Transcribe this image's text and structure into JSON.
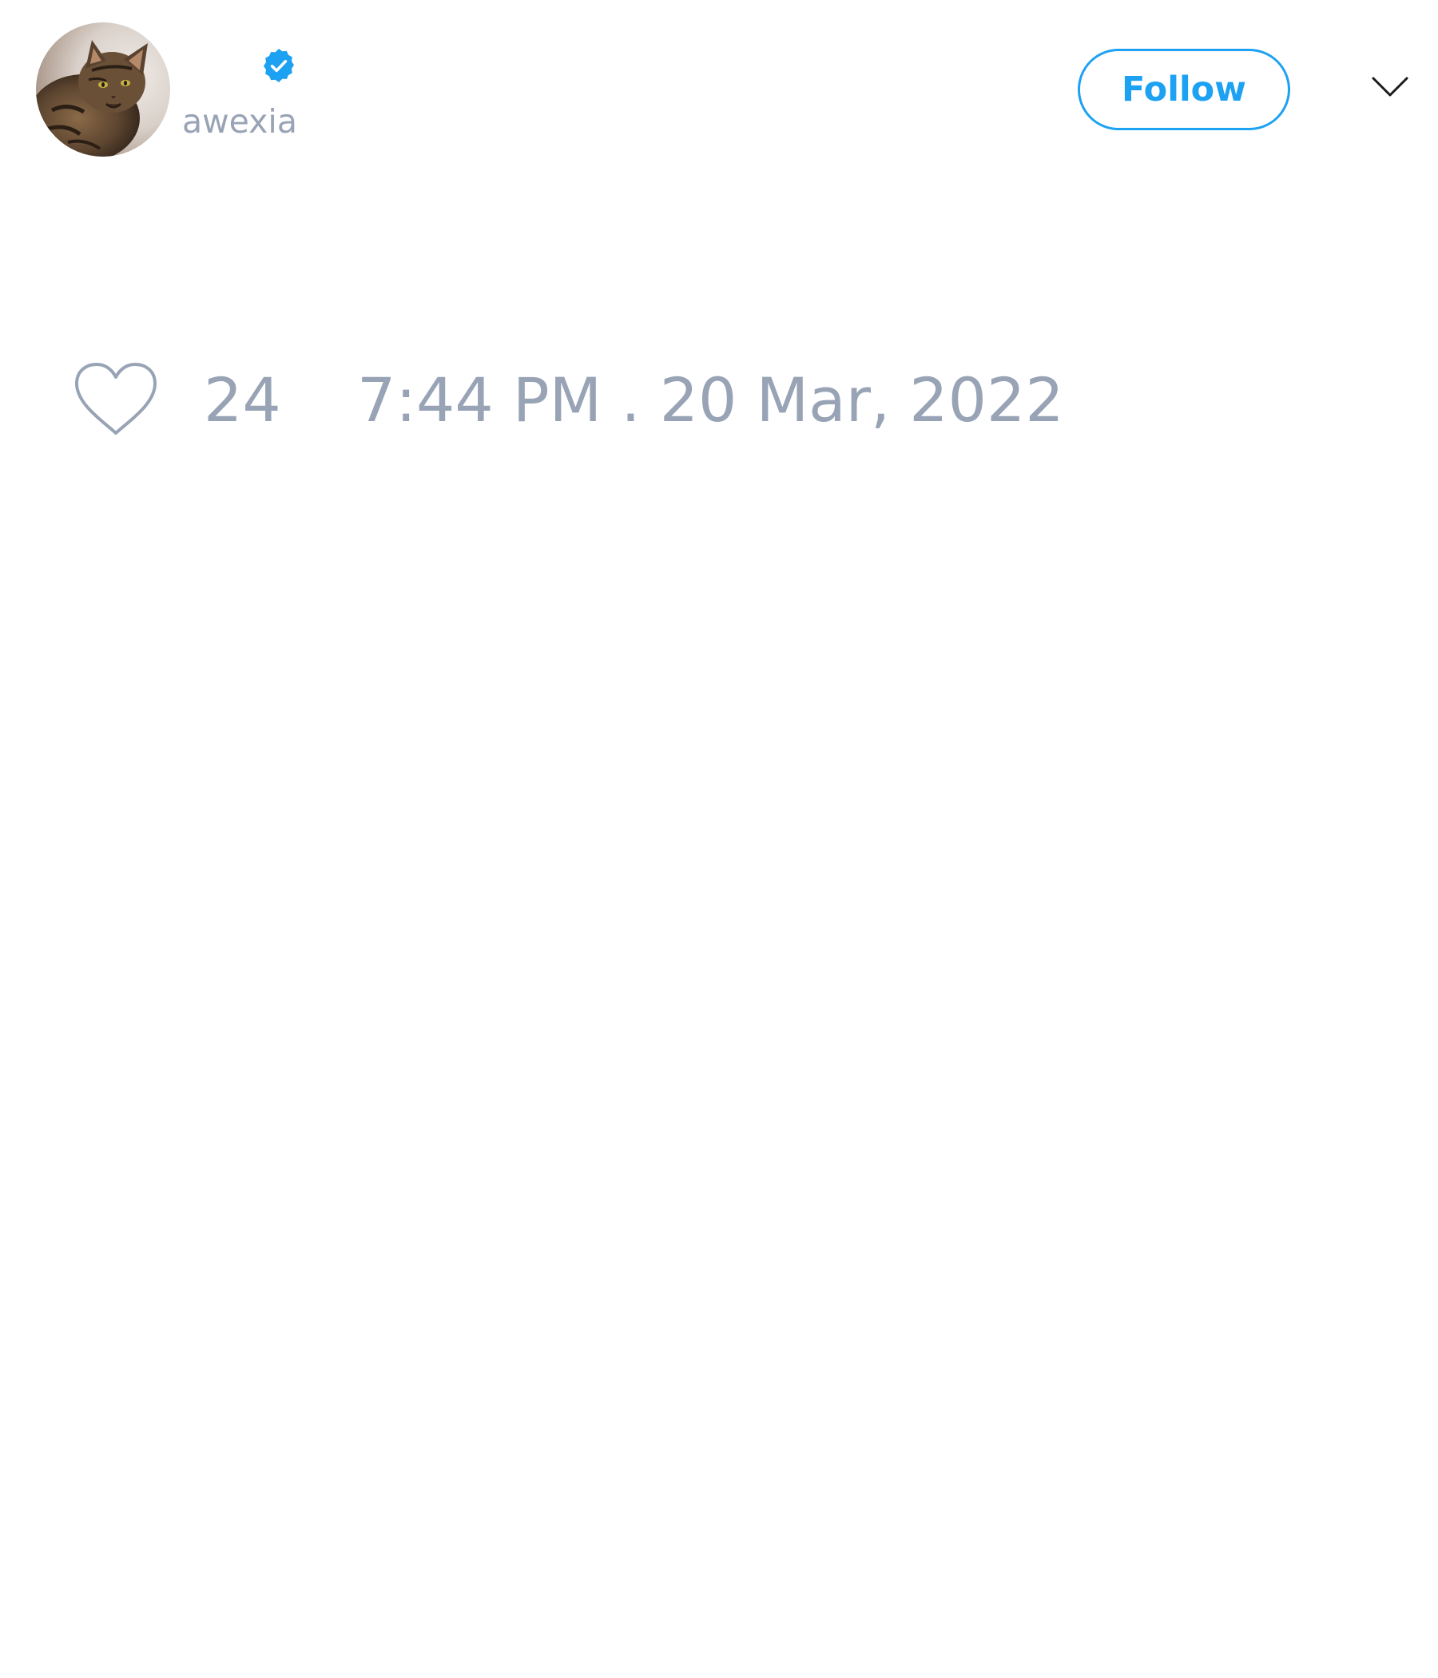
{
  "header": {
    "display_name": "",
    "verified": true,
    "username": "awexia",
    "follow_label": "Follow",
    "menu_icon": "chevron-down-icon"
  },
  "avatar": {
    "icon": "cat-avatar"
  },
  "footer": {
    "like_icon": "heart-outline-icon",
    "like_count": "24",
    "timestamp": "7:44 PM . 20 Mar, 2022"
  },
  "colors": {
    "accent": "#1da1f2",
    "muted_text": "#98a3b5",
    "background": "#ffffff"
  }
}
